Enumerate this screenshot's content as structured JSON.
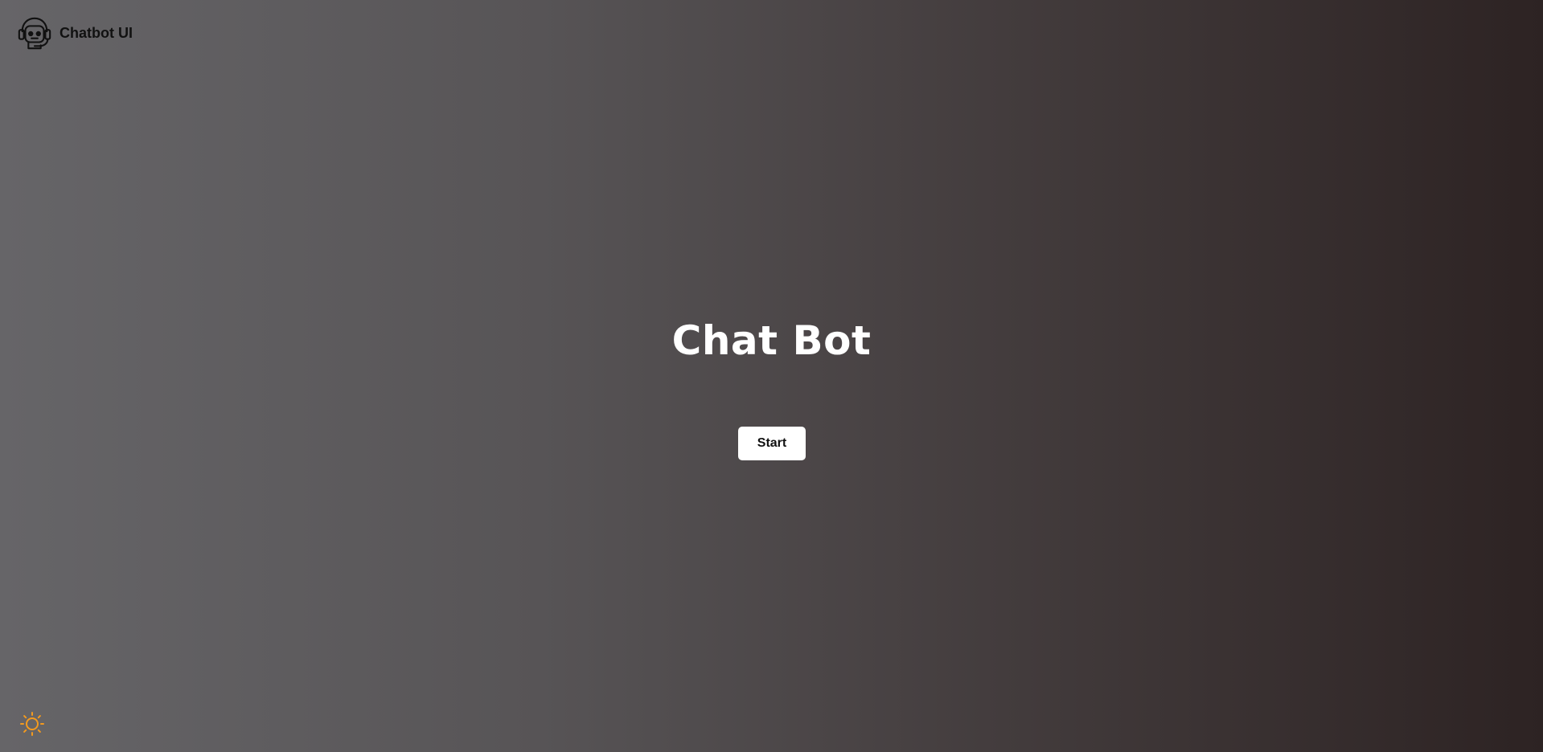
{
  "brand": {
    "name": "Chatbot UI",
    "logo_icon": "robot-headset-icon"
  },
  "hero": {
    "title": "Chat Bot"
  },
  "actions": {
    "start_label": "Start"
  },
  "theme_toggle": {
    "icon": "sun-icon",
    "color": "#f39a1e"
  },
  "colors": {
    "background_start": "#666568",
    "background_end": "#2d2323",
    "title": "#ffffff",
    "button_bg": "#ffffff",
    "button_text": "#111111"
  }
}
